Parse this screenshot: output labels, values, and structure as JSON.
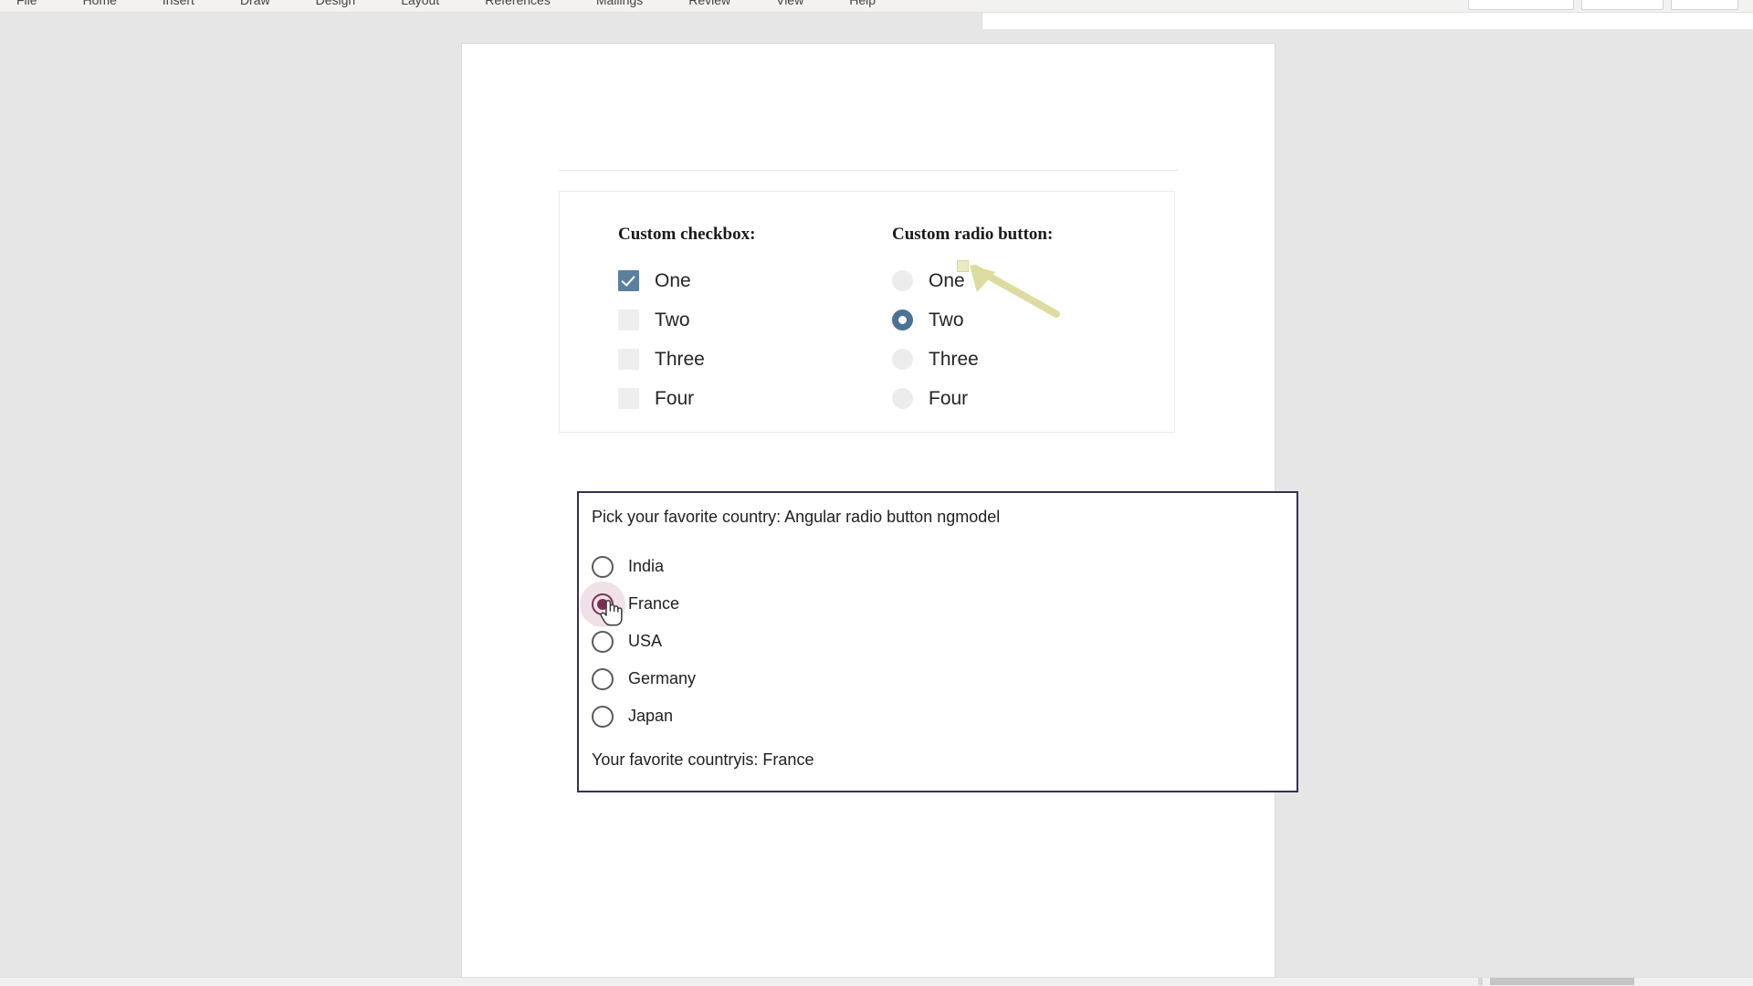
{
  "app": {
    "ribbon_tabs": [
      "File",
      "Home",
      "Insert",
      "Draw",
      "Design",
      "Layout",
      "References",
      "Mailings",
      "Review",
      "View",
      "Help"
    ],
    "ribbon_right": [
      "",
      "",
      ""
    ]
  },
  "checkbox_card": {
    "checkbox_group": {
      "title": "Custom checkbox:",
      "options": [
        {
          "label": "One",
          "checked": true
        },
        {
          "label": "Two",
          "checked": false
        },
        {
          "label": "Three",
          "checked": false
        },
        {
          "label": "Four",
          "checked": false
        }
      ]
    },
    "radio_group": {
      "title": "Custom radio button:",
      "options": [
        {
          "label": "One",
          "selected": false
        },
        {
          "label": "Two",
          "selected": true
        },
        {
          "label": "Three",
          "selected": false
        },
        {
          "label": "Four",
          "selected": false
        }
      ]
    }
  },
  "annotation": {
    "type": "arrow",
    "color": "#dedba0",
    "points_at": "One"
  },
  "country_box": {
    "title": "Pick your favorite country: Angular radio button ngmodel",
    "options": [
      {
        "label": "India",
        "selected": false
      },
      {
        "label": "France",
        "selected": true
      },
      {
        "label": "USA",
        "selected": false
      },
      {
        "label": "Germany",
        "selected": false
      },
      {
        "label": "Japan",
        "selected": false
      }
    ],
    "result": "Your favorite countryis: France",
    "border_color": "#343157",
    "accent_color": "#7b3053"
  },
  "colors": {
    "checkbox_checked": "#5c7f9d",
    "radio_checked": "#4c7296",
    "control_idle": "#ececec",
    "page_background": "#e6e6e6"
  }
}
